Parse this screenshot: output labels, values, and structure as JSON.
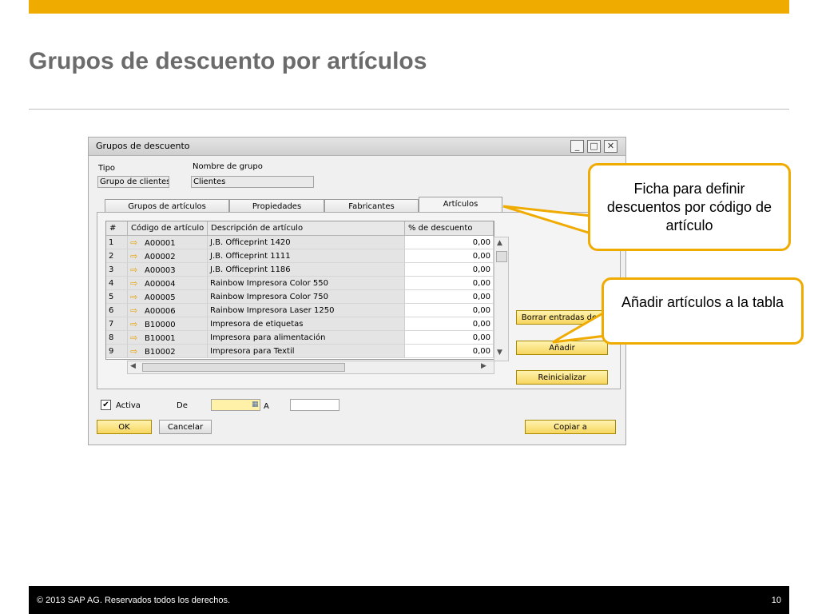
{
  "slide": {
    "title": "Grupos de descuento por artículos",
    "footer_text": "© 2013 SAP AG. Reservados todos los derechos.",
    "page_number": "10"
  },
  "window": {
    "title": "Grupos de descuento",
    "tipo_label": "Tipo",
    "tipo_value": "Grupo de clientes",
    "nombre_label": "Nombre de grupo",
    "nombre_value": "Clientes",
    "tabs": [
      "Grupos de artículos",
      "Propiedades",
      "Fabricantes",
      "Artículos"
    ],
    "active_tab": "Artículos",
    "table": {
      "headers": [
        "#",
        "Código de artículo",
        "Descripción de artículo",
        "% de descuento"
      ],
      "rows": [
        {
          "n": "1",
          "code": "A00001",
          "desc": "J.B. Officeprint 1420",
          "pct": "0,00"
        },
        {
          "n": "2",
          "code": "A00002",
          "desc": "J.B. Officeprint 1111",
          "pct": "0,00"
        },
        {
          "n": "3",
          "code": "A00003",
          "desc": "J.B. Officeprint 1186",
          "pct": "0,00"
        },
        {
          "n": "4",
          "code": "A00004",
          "desc": "Rainbow Impresora Color 550",
          "pct": "0,00"
        },
        {
          "n": "5",
          "code": "A00005",
          "desc": "Rainbow Impresora Color 750",
          "pct": "0,00"
        },
        {
          "n": "6",
          "code": "A00006",
          "desc": "Rainbow Impresora Laser 1250",
          "pct": "0,00"
        },
        {
          "n": "7",
          "code": "B10000",
          "desc": "Impresora de etiquetas",
          "pct": "0,00"
        },
        {
          "n": "8",
          "code": "B10001",
          "desc": "Impresora para alimentación",
          "pct": "0,00"
        },
        {
          "n": "9",
          "code": "B10002",
          "desc": "Impresora para Textil",
          "pct": "0,00"
        }
      ]
    },
    "buttons": {
      "borrar": "Borrar entradas de t",
      "anadir": "Añadir",
      "reinicializar": "Reinicializar",
      "ok": "OK",
      "cancelar": "Cancelar",
      "copiar": "Copiar a"
    },
    "activa_label": "Activa",
    "activa_checked": true,
    "de_label": "De",
    "a_label": "A",
    "de_value": "",
    "a_value": ""
  },
  "callouts": {
    "ficha": "Ficha para definir descuentos por código de artículo",
    "anadir": "Añadir artículos a la tabla"
  },
  "colors": {
    "accent": "#f0ab00",
    "title": "#6b6b6b",
    "footer_bg": "#000000"
  },
  "icons": [
    "close-icon",
    "maximize-icon",
    "minimize-icon",
    "arrow-link-icon",
    "checkbox-icon",
    "calendar-icon"
  ]
}
